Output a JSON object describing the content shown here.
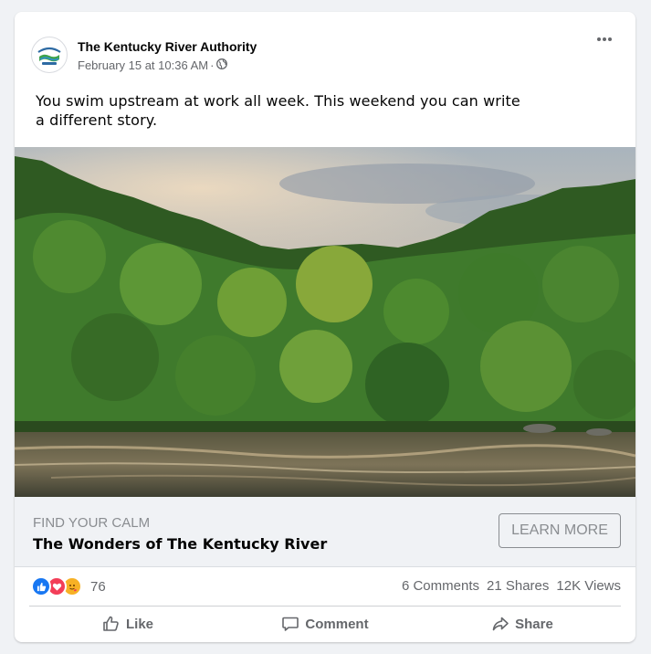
{
  "post": {
    "page_name": "The Kentucky River Authority",
    "date": "February 15 at 10:36 AM",
    "separator": "·",
    "privacy_icon": "globe-icon",
    "text": "You swim upstream at work all week. This weekend you can write a different story."
  },
  "link": {
    "caption": "FIND YOUR CALM",
    "title": "The Wonders of The Kentucky River",
    "cta_label": "LEARN MORE"
  },
  "stats": {
    "reaction_icons": [
      "like-icon",
      "love-icon",
      "care-icon"
    ],
    "reaction_count": "76",
    "comments": "6 Comments",
    "shares": "21 Shares",
    "views": "12K Views"
  },
  "actions": {
    "like": "Like",
    "comment": "Comment",
    "share": "Share"
  },
  "colors": {
    "like_blue": "#1877f2",
    "love_red": "#f33e58",
    "care_yellow": "#f7b125",
    "secondary_text": "#65676b"
  }
}
